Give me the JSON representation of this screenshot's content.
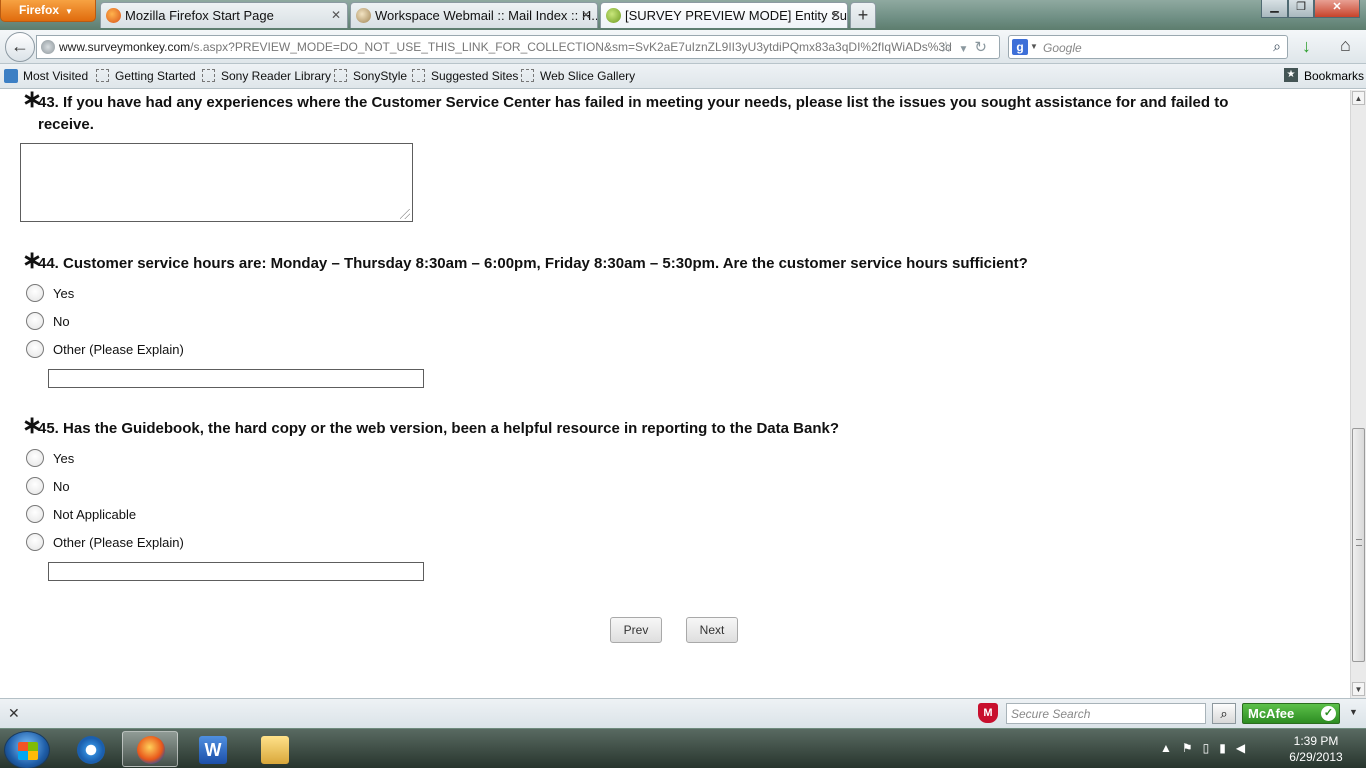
{
  "browser": {
    "menu_label": "Firefox",
    "tabs": [
      {
        "label": "Mozilla Firefox Start Page",
        "active": false
      },
      {
        "label": "Workspace Webmail :: Mail Index :: H...",
        "active": false
      },
      {
        "label": "[SURVEY PREVIEW MODE] Entity Surv...",
        "active": true
      }
    ],
    "url_domain": "www.surveymonkey.com",
    "url_path": "/s.aspx?PREVIEW_MODE=DO_NOT_USE_THIS_LINK_FOR_COLLECTION&sm=SvK2aE7uIznZL9II3yU3ytdiPQmx83a3qDI%2fIqWiADs%3d",
    "search_placeholder": "Google",
    "bookmarks": [
      "Most Visited",
      "Getting Started",
      "Sony Reader Library",
      "SonyStyle",
      "Suggested Sites",
      "Web Slice Gallery"
    ],
    "bookmarks_menu": "Bookmarks"
  },
  "survey": {
    "q43": {
      "title_line1": "43. If you have had any experiences where the Customer Service Center has failed in meeting your needs, please list the issues you sought assistance for and failed to",
      "title_line2": "receive.",
      "answer": ""
    },
    "q44": {
      "title": "44. Customer service hours are: Monday – Thursday 8:30am – 6:00pm, Friday 8:30am – 5:30pm. Are the customer service hours sufficient?",
      "options": [
        "Yes",
        "No",
        "Other (Please Explain)"
      ],
      "explain_value": ""
    },
    "q45": {
      "title": "45. Has the Guidebook, the hard copy or the web version, been a helpful resource in reporting to the Data Bank?",
      "options": [
        "Yes",
        "No",
        "Not Applicable",
        "Other (Please Explain)"
      ],
      "explain_value": ""
    },
    "required_mark": "∗",
    "prev_label": "Prev",
    "next_label": "Next"
  },
  "addon_bar": {
    "secure_search_placeholder": "Secure Search",
    "mcafee_label": "McAfee"
  },
  "taskbar": {
    "time": "1:39 PM",
    "date": "6/29/2013"
  }
}
